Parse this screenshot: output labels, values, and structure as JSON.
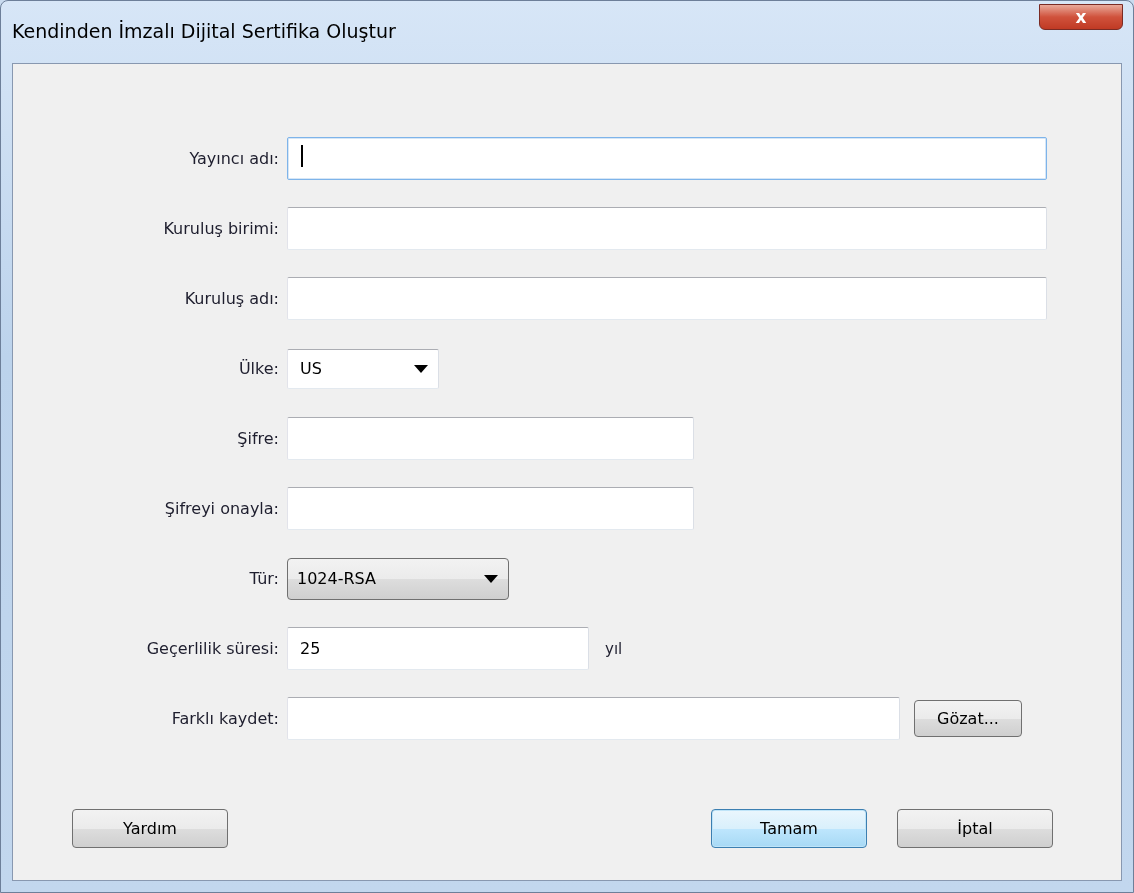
{
  "window": {
    "title": "Kendinden İmzalı Dijital Sertifika Oluştur",
    "close": "x"
  },
  "fields": [
    {
      "label": "Yayıncı adı:",
      "kind": "text",
      "focused": true
    },
    {
      "label": "Kuruluş birimi:",
      "kind": "text",
      "focused": false
    },
    {
      "label": "Kuruluş adı:",
      "kind": "text",
      "focused": false
    },
    {
      "label": "Ülke:",
      "kind": "select",
      "value": "US",
      "focused": false
    },
    {
      "label": "Şifre:",
      "kind": "text",
      "focused": false
    },
    {
      "label": "Şifreyi onayla:",
      "kind": "text",
      "focused": false
    },
    {
      "label": "Tür:",
      "kind": "button-select",
      "value": "1024-RSA",
      "focused": false
    },
    {
      "label": "Geçerlilik süresi:",
      "kind": "text",
      "value": "25",
      "suffix": "yıl",
      "focused": false
    },
    {
      "label": "Farklı kaydet:",
      "kind": "text",
      "button": "Gözat...",
      "focused": false
    }
  ],
  "footer": {
    "left_buttons": [
      {
        "label": "Yardım",
        "default": false
      }
    ],
    "right_buttons": [
      {
        "label": "Tamam",
        "default": true
      },
      {
        "label": "İptal",
        "default": false
      }
    ]
  }
}
